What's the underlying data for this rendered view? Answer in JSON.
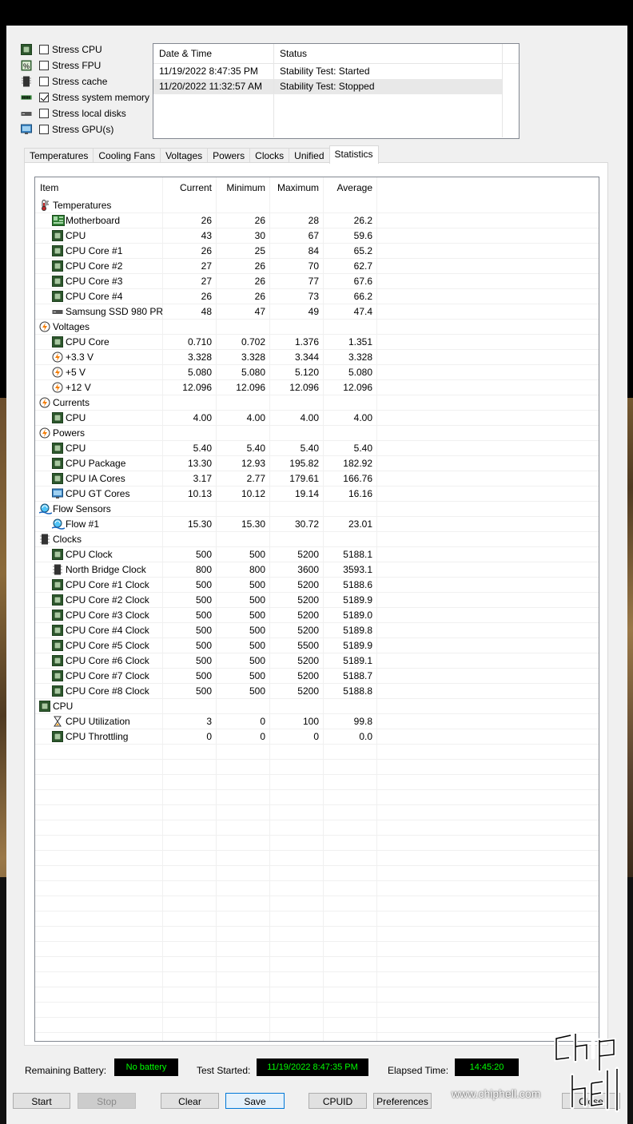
{
  "stress": [
    {
      "label": "Stress CPU",
      "checked": false,
      "icon": "cpu-icon"
    },
    {
      "label": "Stress FPU",
      "checked": false,
      "icon": "fpu-icon"
    },
    {
      "label": "Stress cache",
      "checked": false,
      "icon": "cache-icon"
    },
    {
      "label": "Stress system memory",
      "checked": true,
      "icon": "memory-icon"
    },
    {
      "label": "Stress local disks",
      "checked": false,
      "icon": "disk-icon"
    },
    {
      "label": "Stress GPU(s)",
      "checked": false,
      "icon": "gpu-icon"
    }
  ],
  "log": {
    "headers": [
      "Date & Time",
      "Status"
    ],
    "rows": [
      {
        "datetime": "11/19/2022 8:47:35 PM",
        "status": "Stability Test: Started"
      },
      {
        "datetime": "11/20/2022 11:32:57 AM",
        "status": "Stability Test: Stopped"
      }
    ]
  },
  "tabs": [
    "Temperatures",
    "Cooling Fans",
    "Voltages",
    "Powers",
    "Clocks",
    "Unified",
    "Statistics"
  ],
  "active_tab": "Statistics",
  "stats": {
    "headers": {
      "item": "Item",
      "current": "Current",
      "minimum": "Minimum",
      "maximum": "Maximum",
      "average": "Average"
    },
    "rows": [
      {
        "level": 1,
        "icon": "thermometer-icon",
        "item": "Temperatures"
      },
      {
        "level": 2,
        "icon": "motherboard-icon",
        "item": "Motherboard",
        "current": "26",
        "minimum": "26",
        "maximum": "28",
        "average": "26.2"
      },
      {
        "level": 2,
        "icon": "cpu-icon",
        "item": "CPU",
        "current": "43",
        "minimum": "30",
        "maximum": "67",
        "average": "59.6"
      },
      {
        "level": 2,
        "icon": "cpu-icon",
        "item": "CPU Core #1",
        "current": "26",
        "minimum": "25",
        "maximum": "84",
        "average": "65.2"
      },
      {
        "level": 2,
        "icon": "cpu-icon",
        "item": "CPU Core #2",
        "current": "27",
        "minimum": "26",
        "maximum": "70",
        "average": "62.7"
      },
      {
        "level": 2,
        "icon": "cpu-icon",
        "item": "CPU Core #3",
        "current": "27",
        "minimum": "26",
        "maximum": "77",
        "average": "67.6"
      },
      {
        "level": 2,
        "icon": "cpu-icon",
        "item": "CPU Core #4",
        "current": "26",
        "minimum": "26",
        "maximum": "73",
        "average": "66.2"
      },
      {
        "level": 2,
        "icon": "ssd-icon",
        "item": "Samsung SSD 980 PR...",
        "current": "48",
        "minimum": "47",
        "maximum": "49",
        "average": "47.4"
      },
      {
        "level": 1,
        "icon": "voltage-icon",
        "item": "Voltages"
      },
      {
        "level": 2,
        "icon": "cpu-icon",
        "item": "CPU Core",
        "current": "0.710",
        "minimum": "0.702",
        "maximum": "1.376",
        "average": "1.351"
      },
      {
        "level": 2,
        "icon": "voltage-icon",
        "item": "+3.3 V",
        "current": "3.328",
        "minimum": "3.328",
        "maximum": "3.344",
        "average": "3.328"
      },
      {
        "level": 2,
        "icon": "voltage-icon",
        "item": "+5 V",
        "current": "5.080",
        "minimum": "5.080",
        "maximum": "5.120",
        "average": "5.080"
      },
      {
        "level": 2,
        "icon": "voltage-icon",
        "item": "+12 V",
        "current": "12.096",
        "minimum": "12.096",
        "maximum": "12.096",
        "average": "12.096"
      },
      {
        "level": 1,
        "icon": "voltage-icon",
        "item": "Currents"
      },
      {
        "level": 2,
        "icon": "cpu-icon",
        "item": "CPU",
        "current": "4.00",
        "minimum": "4.00",
        "maximum": "4.00",
        "average": "4.00"
      },
      {
        "level": 1,
        "icon": "voltage-icon",
        "item": "Powers"
      },
      {
        "level": 2,
        "icon": "cpu-icon",
        "item": "CPU",
        "current": "5.40",
        "minimum": "5.40",
        "maximum": "5.40",
        "average": "5.40"
      },
      {
        "level": 2,
        "icon": "cpu-icon",
        "item": "CPU Package",
        "current": "13.30",
        "minimum": "12.93",
        "maximum": "195.82",
        "average": "182.92"
      },
      {
        "level": 2,
        "icon": "cpu-icon",
        "item": "CPU IA Cores",
        "current": "3.17",
        "minimum": "2.77",
        "maximum": "179.61",
        "average": "166.76"
      },
      {
        "level": 2,
        "icon": "gpu-icon",
        "item": "CPU GT Cores",
        "current": "10.13",
        "minimum": "10.12",
        "maximum": "19.14",
        "average": "16.16"
      },
      {
        "level": 1,
        "icon": "flow-icon",
        "item": "Flow Sensors"
      },
      {
        "level": 2,
        "icon": "flow-icon",
        "item": "Flow #1",
        "current": "15.30",
        "minimum": "15.30",
        "maximum": "30.72",
        "average": "23.01"
      },
      {
        "level": 1,
        "icon": "clock-icon",
        "item": "Clocks"
      },
      {
        "level": 2,
        "icon": "cpu-icon",
        "item": "CPU Clock",
        "current": "500",
        "minimum": "500",
        "maximum": "5200",
        "average": "5188.1"
      },
      {
        "level": 2,
        "icon": "chip-icon",
        "item": "North Bridge Clock",
        "current": "800",
        "minimum": "800",
        "maximum": "3600",
        "average": "3593.1"
      },
      {
        "level": 2,
        "icon": "cpu-icon",
        "item": "CPU Core #1 Clock",
        "current": "500",
        "minimum": "500",
        "maximum": "5200",
        "average": "5188.6"
      },
      {
        "level": 2,
        "icon": "cpu-icon",
        "item": "CPU Core #2 Clock",
        "current": "500",
        "minimum": "500",
        "maximum": "5200",
        "average": "5189.9"
      },
      {
        "level": 2,
        "icon": "cpu-icon",
        "item": "CPU Core #3 Clock",
        "current": "500",
        "minimum": "500",
        "maximum": "5200",
        "average": "5189.0"
      },
      {
        "level": 2,
        "icon": "cpu-icon",
        "item": "CPU Core #4 Clock",
        "current": "500",
        "minimum": "500",
        "maximum": "5200",
        "average": "5189.8"
      },
      {
        "level": 2,
        "icon": "cpu-icon",
        "item": "CPU Core #5 Clock",
        "current": "500",
        "minimum": "500",
        "maximum": "5500",
        "average": "5189.9"
      },
      {
        "level": 2,
        "icon": "cpu-icon",
        "item": "CPU Core #6 Clock",
        "current": "500",
        "minimum": "500",
        "maximum": "5200",
        "average": "5189.1"
      },
      {
        "level": 2,
        "icon": "cpu-icon",
        "item": "CPU Core #7 Clock",
        "current": "500",
        "minimum": "500",
        "maximum": "5200",
        "average": "5188.7"
      },
      {
        "level": 2,
        "icon": "cpu-icon",
        "item": "CPU Core #8 Clock",
        "current": "500",
        "minimum": "500",
        "maximum": "5200",
        "average": "5188.8"
      },
      {
        "level": 1,
        "icon": "cpu-icon",
        "item": "CPU"
      },
      {
        "level": 2,
        "icon": "hourglass-icon",
        "item": "CPU Utilization",
        "current": "3",
        "minimum": "0",
        "maximum": "100",
        "average": "99.8"
      },
      {
        "level": 2,
        "icon": "cpu-icon",
        "item": "CPU Throttling",
        "current": "0",
        "minimum": "0",
        "maximum": "0",
        "average": "0.0"
      }
    ]
  },
  "status_bar": {
    "battery_label": "Remaining Battery:",
    "battery_value": "No battery",
    "started_label": "Test Started:",
    "started_value": "11/19/2022 8:47:35 PM",
    "elapsed_label": "Elapsed Time:",
    "elapsed_value": "14:45:20"
  },
  "buttons": {
    "start": "Start",
    "stop": "Stop",
    "clear": "Clear",
    "save": "Save",
    "cpuid": "CPUID",
    "preferences": "Preferences",
    "close": "Close"
  },
  "watermark": "www.chiphell.com"
}
